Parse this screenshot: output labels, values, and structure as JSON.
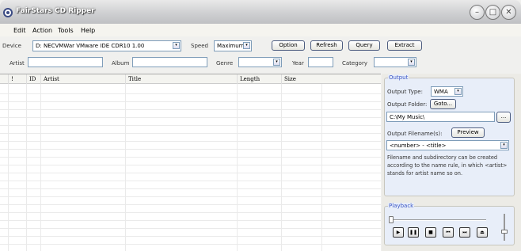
{
  "window": {
    "title": "FairStars CD Ripper"
  },
  "menu": [
    "Edit",
    "Action",
    "Tools",
    "Help"
  ],
  "toolbar": {
    "device_label": "Device",
    "device_value": "D: NECVMWar VMware IDE CDR10 1.00",
    "speed_label": "Speed",
    "speed_value": "Maximum",
    "option": "Option",
    "refresh": "Refresh",
    "query": "Query",
    "extract": "Extract"
  },
  "fields": {
    "artist": "Artist",
    "album": "Album",
    "genre": "Genre",
    "year": "Year",
    "category": "Category"
  },
  "grid": {
    "columns": [
      "!",
      "ID",
      "Artist",
      "Title",
      "Length",
      "Size"
    ]
  },
  "output": {
    "group_title": "Output",
    "type_label": "Output Type:",
    "type_value": "WMA",
    "folder_label": "Output Folder:",
    "goto": "Goto...",
    "folder_value": "C:\\My Music\\",
    "browse": "...",
    "filename_label": "Output Filename(s):",
    "preview": "Preview",
    "filename_value": "<number> - <title>",
    "note": "Filename and subdirectory can be created according to the name rule, in which <artist> stands for artist name so on."
  },
  "playback": {
    "group_title": "Playback",
    "buttons": [
      "play",
      "pause",
      "stop",
      "previous",
      "next",
      "eject"
    ]
  },
  "colors": {
    "accent": "#3a55c5",
    "border": "#7f9db9"
  }
}
